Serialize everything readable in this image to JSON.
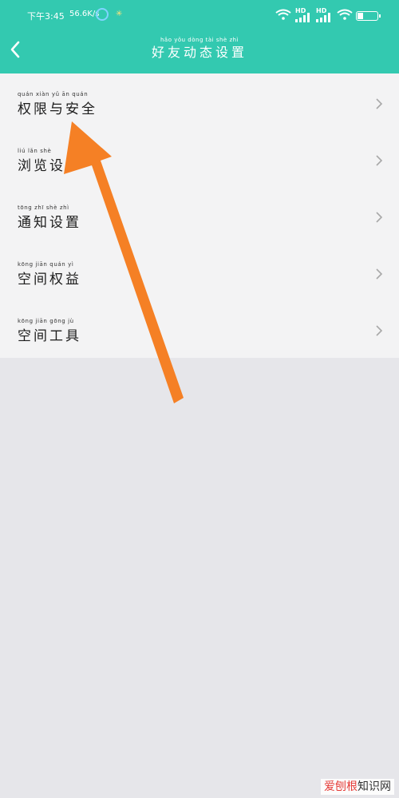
{
  "status_bar": {
    "time": "下午3:45",
    "network_speed": "56.6K/s",
    "hd1": "HD",
    "hd2": "HD"
  },
  "header": {
    "title": "好友动态设置",
    "title_pinyin": "hǎo yǒu dòng tài shè zhì",
    "background": "#33c9b0"
  },
  "menu": {
    "items": [
      {
        "label": "权限与安全",
        "pinyin": "quán xiàn yǔ ān quán"
      },
      {
        "label": "浏览设",
        "pinyin": "liú lǎn shè"
      },
      {
        "label": "通知设置",
        "pinyin": "tōng zhī shè zhì"
      },
      {
        "label": "空间权益",
        "pinyin": "kōng jiān quán yì"
      },
      {
        "label": "空间工具",
        "pinyin": "kōng jiān gōng jù"
      }
    ]
  },
  "annotation": {
    "color": "#f58025"
  },
  "watermark": {
    "part1": "爱刨根",
    "part2": "知识网"
  }
}
